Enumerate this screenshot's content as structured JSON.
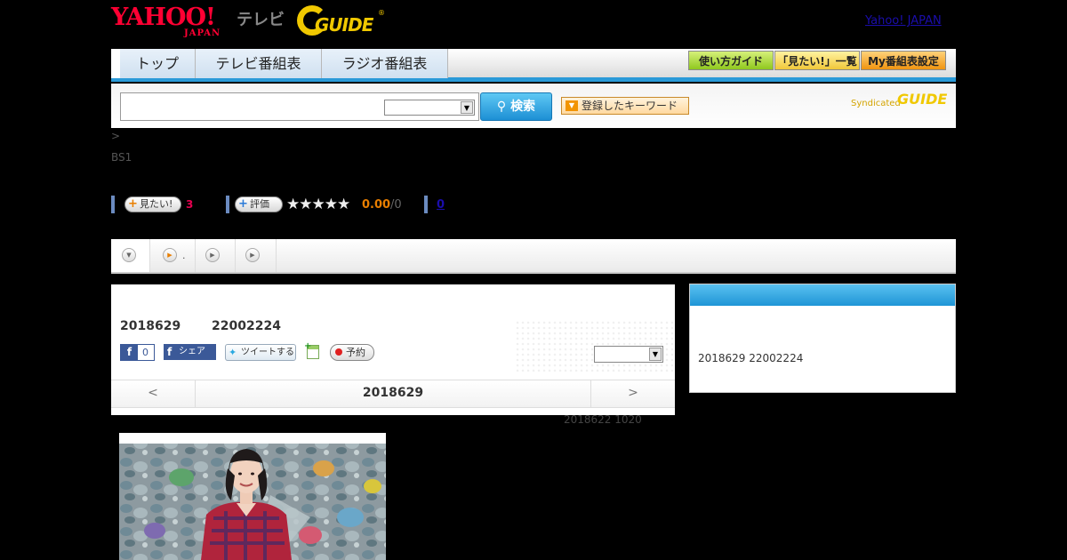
{
  "header": {
    "yahoo_logo": "YAHOO!",
    "yahoo_logo_sub": "JAPAN",
    "tv_label": "テレビ",
    "gguide_logo": "GUIDE",
    "gguide_mark": "®",
    "yahoo_japan_link": "Yahoo! JAPAN"
  },
  "nav": {
    "tabs": [
      {
        "label": "トップ"
      },
      {
        "label": "テレビ番組表"
      },
      {
        "label": "ラジオ番組表"
      }
    ],
    "buttons": [
      {
        "label": "使い方ガイド",
        "color": "#a6d832"
      },
      {
        "label": "「見たい!」一覧",
        "color": "#f6d44a"
      },
      {
        "label": "My番組表設定",
        "color": "#f5a21e"
      }
    ]
  },
  "search": {
    "input_value": "",
    "select_value": "",
    "button_label": "検索",
    "keyword_button": "登録したキーワード",
    "syndicated_label": "Syndicated",
    "syndicated_logo": "GUIDE"
  },
  "breadcrumb": ">",
  "channel": "BS1",
  "actions": {
    "want_label": "見たい!",
    "want_count": "3",
    "rate_label": "評価",
    "stars": "★★★★★",
    "score": "0.00",
    "score_total": "/0",
    "review_count": "0"
  },
  "subtabs": [
    {
      "icon": "chevron-down-icon",
      "text": ""
    },
    {
      "icon": "play-icon",
      "text": "."
    },
    {
      "icon": "play-icon",
      "text": ""
    },
    {
      "icon": "play-icon",
      "text": ""
    }
  ],
  "program": {
    "air_date": "2018629",
    "air_time": "22002224",
    "fb_like_count": "0",
    "fb_share_label": "シェア",
    "tweet_label": "ツイートする",
    "record_label": "予約",
    "panel_select_value": "",
    "prev_arrow": "<",
    "nav_date": "2018629",
    "next_arrow": ">",
    "updated": "2018622  1020"
  },
  "side": {
    "text": "2018629  22002224"
  },
  "colors": {
    "accent_blue": "#2a9ad8",
    "want_count": "#e5004f",
    "score": "#e87e00"
  }
}
